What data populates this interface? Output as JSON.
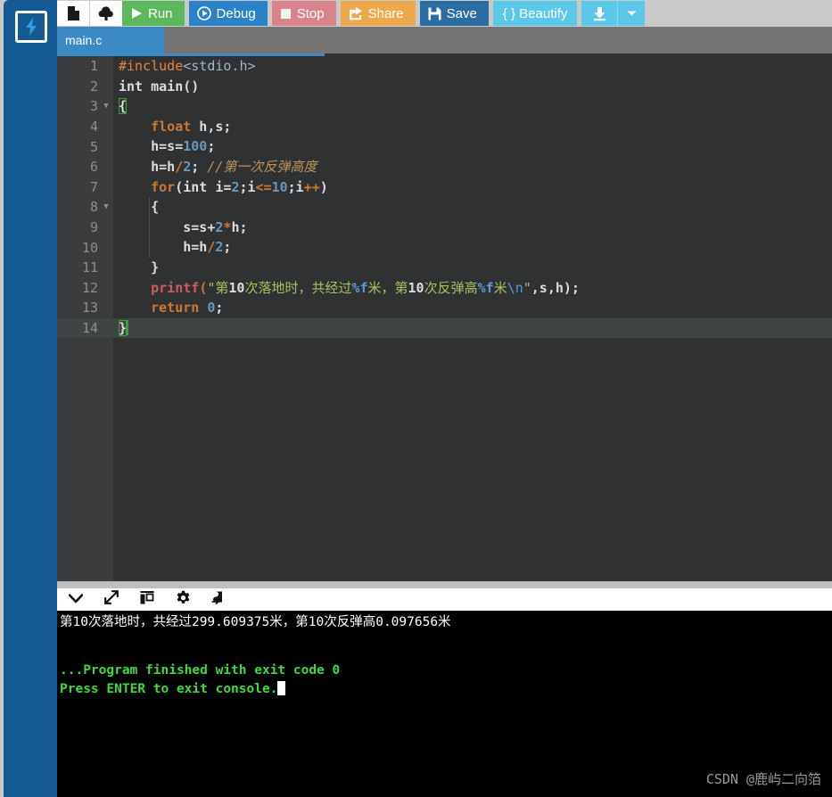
{
  "app": {
    "logo_icon": "lightning-bolt-icon",
    "accent_blue": "#155a92"
  },
  "toolbar": {
    "new_file_icon": "new-file-icon",
    "upload_icon": "upload-cloud-icon",
    "run_label": "Run",
    "debug_label": "Debug",
    "stop_label": "Stop",
    "share_label": "Share",
    "save_label": "Save",
    "beautify_label": "{ } Beautify",
    "download_icon": "download-icon",
    "caret_icon": "chevron-down-icon",
    "colors": {
      "run": "#5cb85c",
      "debug": "#2b82c9",
      "stop": "#d9848b",
      "share": "#eda84b",
      "save": "#2b6ca3",
      "beautify": "#5bc8ea"
    }
  },
  "tabs": [
    {
      "label": "main.c",
      "active": true
    }
  ],
  "editor": {
    "language": "c",
    "active_line": 14,
    "lines": [
      {
        "n": "1",
        "fold": false
      },
      {
        "n": "2",
        "fold": false
      },
      {
        "n": "3",
        "fold": true
      },
      {
        "n": "4",
        "fold": false
      },
      {
        "n": "5",
        "fold": false
      },
      {
        "n": "6",
        "fold": false
      },
      {
        "n": "7",
        "fold": false
      },
      {
        "n": "8",
        "fold": true
      },
      {
        "n": "9",
        "fold": false
      },
      {
        "n": "10",
        "fold": false
      },
      {
        "n": "11",
        "fold": false
      },
      {
        "n": "12",
        "fold": false
      },
      {
        "n": "13",
        "fold": false
      },
      {
        "n": "14",
        "fold": false
      }
    ],
    "source": [
      "#include<stdio.h>",
      "int main()",
      "{",
      "    float h,s;",
      "    h=s=100;",
      "    h=h/2; //第一次反弹高度",
      "    for(int i=2;i<=10;i++)",
      "    {",
      "        s=s+2*h;",
      "        h=h/2;",
      "    }",
      "    printf(\"第10次落地时，共经过%f米，第10次反弹高%f米\\n\",s,h);",
      "    return 0;",
      "}"
    ]
  },
  "console_tools": {
    "collapse_icon": "chevron-down-icon",
    "expand_icon": "expand-arrows-icon",
    "layout_icon": "panel-layout-icon",
    "settings_icon": "gear-icon",
    "stdin_icon": "stdin-import-icon"
  },
  "console": {
    "program_output": "第10次落地时，共经过299.609375米，第10次反弹高0.097656米",
    "exit_line": "...Program finished with exit code 0",
    "prompt_line": "Press ENTER to exit console.",
    "output_color": "#ffffff",
    "status_color": "#3ddb3d"
  },
  "watermark": {
    "text": "CSDN @鹿屿二向箔"
  }
}
